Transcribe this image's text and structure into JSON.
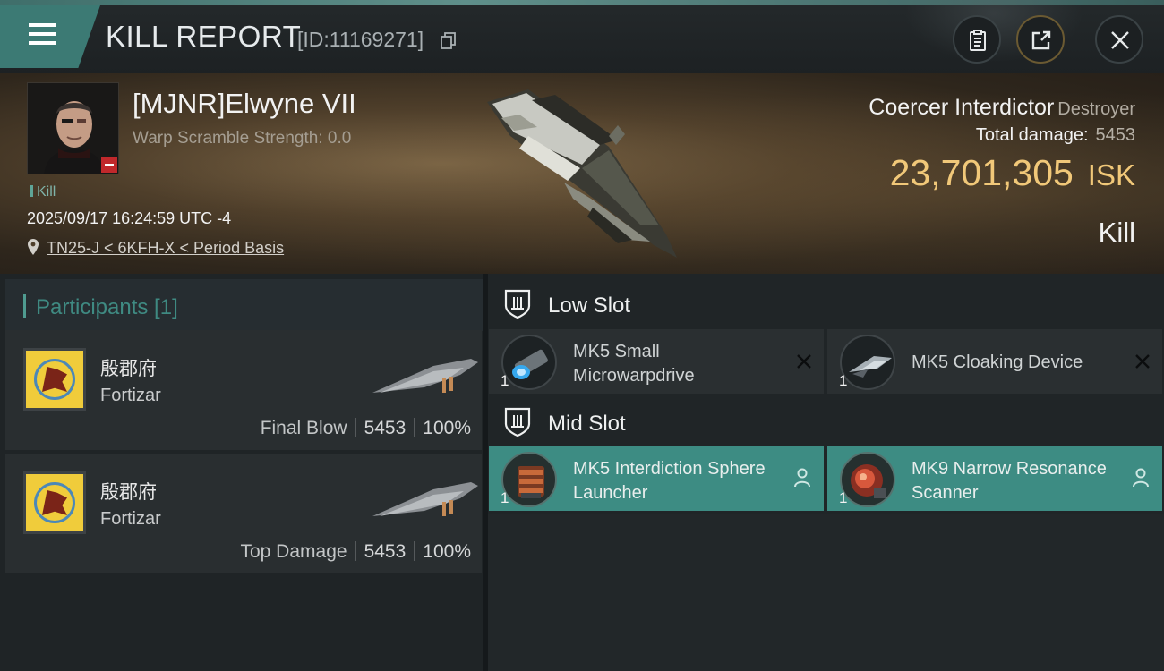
{
  "header": {
    "title": "KILL REPORT",
    "report_id": "[ID:11169271]"
  },
  "victim": {
    "pilot": "[MJNR]Elwyne VII",
    "warp_scramble": "Warp Scramble Strength: 0.0",
    "tag": "Kill",
    "datetime": "2025/09/17 16:24:59 UTC -4",
    "location": "TN25-J < 6KFH-X < Period Basis",
    "ship_name": "Coercer Interdictor",
    "ship_class": "Destroyer",
    "total_damage_label": "Total damage:",
    "total_damage": "5453",
    "isk_value": "23,701,305",
    "isk_unit": "ISK",
    "outcome": "Kill"
  },
  "participants": {
    "title": "Participants [1]",
    "items": [
      {
        "name": "殷郡府",
        "ship": "Fortizar",
        "label": "Final Blow",
        "damage": "5453",
        "percent": "100%"
      },
      {
        "name": "殷郡府",
        "ship": "Fortizar",
        "label": "Top Damage",
        "damage": "5453",
        "percent": "100%"
      }
    ]
  },
  "fitting": {
    "low_slot": {
      "title": "Low Slot",
      "modules": [
        {
          "name": "MK5 Small Microwarpdrive",
          "qty": "1"
        },
        {
          "name": "MK5 Cloaking Device",
          "qty": "1"
        }
      ]
    },
    "mid_slot": {
      "title": "Mid Slot",
      "modules": [
        {
          "name": "MK5 Interdiction Sphere Launcher",
          "qty": "1"
        },
        {
          "name": "MK9 Narrow Resonance Scanner",
          "qty": "1"
        }
      ]
    }
  },
  "colors": {
    "accent_teal": "#3d8c83",
    "isk_gold": "#f1c879",
    "negative_red": "#c0282b"
  },
  "icons": [
    "menu-icon",
    "copy-icon",
    "clipboard-icon",
    "share-icon",
    "close-icon",
    "location-pin-icon",
    "low-slot-icon",
    "mid-slot-icon",
    "remove-icon",
    "person-icon"
  ]
}
